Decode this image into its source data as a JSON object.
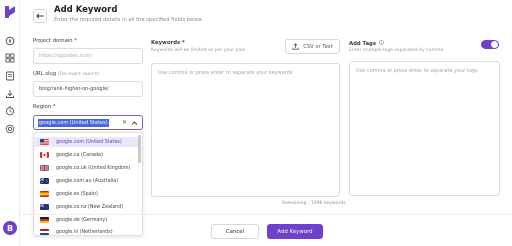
{
  "header": {
    "title": "Add Keyword",
    "subtitle": "Enter the required details in all the specified fields below"
  },
  "sidebar": {
    "avatar_letter": "B",
    "icons": [
      "logo-icon",
      "compass-icon",
      "grid-icon",
      "document-icon",
      "download-icon",
      "clock-icon",
      "target-icon"
    ]
  },
  "form": {
    "project_domain": {
      "label": "Project domain *",
      "placeholder": "https://appsdex.com/"
    },
    "url_slug": {
      "label": "URL slug",
      "hint": "(For exact search)",
      "value": "blog/rank-higher-on-google/"
    },
    "region": {
      "label": "Region *",
      "selected": "google.com (United States)",
      "options": [
        {
          "label": "google.com (United States)",
          "flag": "us"
        },
        {
          "label": "google.ca (Canada)",
          "flag": "ca"
        },
        {
          "label": "google.co.uk (United Kingdom)",
          "flag": "uk"
        },
        {
          "label": "google.com.au (Australia)",
          "flag": "au"
        },
        {
          "label": "google.es (Spain)",
          "flag": "es"
        },
        {
          "label": "google.co.nz (New Zealand)",
          "flag": "nz"
        },
        {
          "label": "google.de (Germany)",
          "flag": "de"
        },
        {
          "label": "google.nl (Netherlands)",
          "flag": "nl"
        }
      ]
    },
    "keywords": {
      "label": "Keywords *",
      "hint": "Keywords will be limited as per your plan",
      "csv_button": "CSV or Text",
      "placeholder": "Use comma or press enter to separate your keywords",
      "remaining": "Remaining : 1996 keywords"
    },
    "tags": {
      "label": "Add Tags",
      "hint": "Enter multiple tags separated by comma",
      "placeholder": "Use comma or press enter to separate your tags",
      "enabled": true
    }
  },
  "footer": {
    "cancel_label": "Cancel",
    "submit_label": "Add Keyword"
  },
  "colors": {
    "accent": "#6f40c9",
    "selection": "#4a67d8",
    "option_selected_bg": "#ece8fb"
  }
}
